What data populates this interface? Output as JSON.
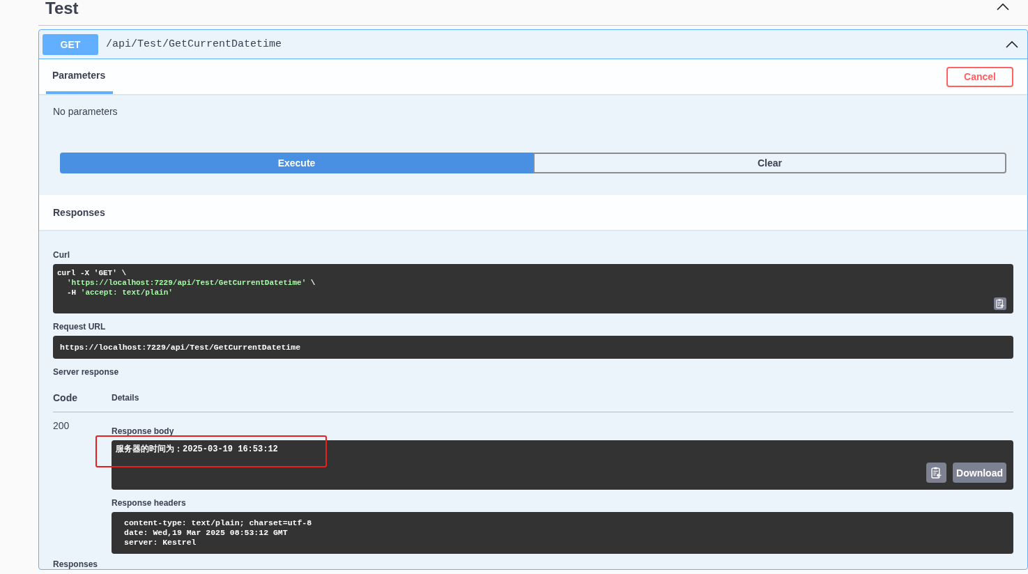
{
  "section": {
    "title": "Test",
    "expanded": true
  },
  "operation": {
    "method": "GET",
    "path": "/api/Test/GetCurrentDatetime",
    "expanded": true
  },
  "tabs": [
    {
      "label": "Parameters",
      "selected": true
    }
  ],
  "cancel_button": "Cancel",
  "parameters": {
    "message": "No parameters"
  },
  "actions": [
    {
      "label": "Execute",
      "kind": "primary"
    },
    {
      "label": "Clear",
      "kind": "secondary"
    }
  ],
  "responses_heading": "Responses",
  "curl": {
    "label": "Curl",
    "lines": [
      {
        "tokens": [
          {
            "kind": "plain",
            "text": "curl -X 'GET' \\"
          }
        ]
      },
      {
        "tokens": [
          {
            "kind": "string",
            "text": "'https://localhost:7229/api/Test/GetCurrentDatetime'"
          },
          {
            "kind": "plain",
            "text": " \\"
          }
        ]
      },
      {
        "tokens": [
          {
            "kind": "plain",
            "text": "-H "
          },
          {
            "kind": "string",
            "text": "'accept: text/plain'"
          }
        ]
      }
    ]
  },
  "request_url": {
    "label": "Request URL",
    "value": "https://localhost:7229/api/Test/GetCurrentDatetime"
  },
  "server_response": {
    "label": "Server response",
    "columns": [
      "Code",
      "Details"
    ],
    "code": "200",
    "body": {
      "label": "Response body",
      "text": "服务器的时间为：2025-03-19 16:53:12",
      "highlighted": true,
      "download_button": "Download"
    },
    "headers": {
      "label": "Response headers",
      "lines": [
        "content-type: text/plain; charset=utf-8",
        "date: Wed,19 Mar 2025 08:53:12 GMT",
        "server: Kestrel"
      ]
    }
  },
  "footer_heading": "Responses"
}
